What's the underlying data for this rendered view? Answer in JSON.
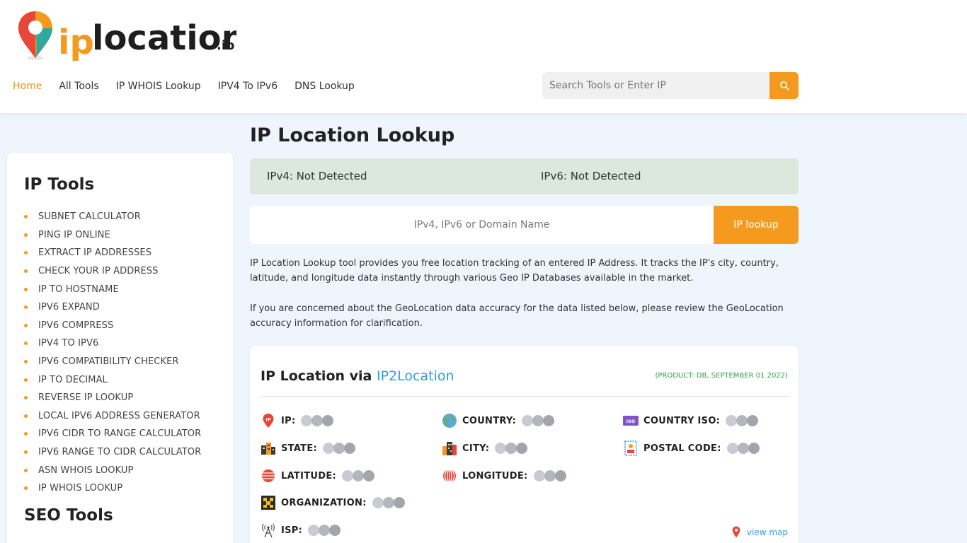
{
  "header": {
    "logo": {
      "brand_prefix": "ip",
      "brand_main": "location",
      "brand_suffix": ".io"
    },
    "nav": [
      "Home",
      "All Tools",
      "IP WHOIS Lookup",
      "IPV4 To IPv6",
      "DNS Lookup"
    ],
    "search_placeholder": "Search Tools or Enter IP"
  },
  "sidebar": {
    "ip_tools_title": "IP Tools",
    "ip_tools": [
      "SUBNET CALCULATOR",
      "PING IP ONLINE",
      "EXTRACT IP ADDRESSES",
      "CHECK YOUR IP ADDRESS",
      "IP TO HOSTNAME",
      "IPV6 EXPAND",
      "IPV6 COMPRESS",
      "IPV4 TO IPV6",
      "IPV6 COMPATIBILITY CHECKER",
      "IP TO DECIMAL",
      "REVERSE IP LOOKUP",
      "LOCAL IPV6 ADDRESS GENERATOR",
      "IPV6 CIDR TO RANGE CALCULATOR",
      "IPV6 RANGE TO CIDR CALCULATOR",
      "ASN WHOIS LOOKUP",
      "IP WHOIS LOOKUP"
    ],
    "seo_tools_title": "SEO Tools"
  },
  "main": {
    "title": "IP Location Lookup",
    "ipv4_status": "IPv4: Not Detected",
    "ipv6_status": "IPv6: Not Detected",
    "lookup_placeholder": "IPv4, IPv6 or Domain Name",
    "lookup_button": "IP lookup",
    "paragraph1": "IP Location Lookup tool provides you free location tracking of an entered IP Address. It tracks the IP's city, country, latitude, and longitude data instantly through various Geo IP Databases available in the market.",
    "paragraph2": "If you are concerned about the GeoLocation data accuracy for the data listed below, please review the GeoLocation accuracy information for clarification."
  },
  "card": {
    "title_prefix": "IP Location via ",
    "title_link": "IP2Location",
    "product": "(PRODUCT: DB, SEPTEMBER 01 2022)",
    "fields": {
      "ip": "IP:",
      "country": "COUNTRY:",
      "country_iso": "COUNTRY ISO:",
      "state": "STATE:",
      "city": "CITY:",
      "postal_code": "POSTAL CODE:",
      "latitude": "LATITUDE:",
      "longitude": "LONGITUDE:",
      "organization": "ORGANIZATION:",
      "isp": "ISP:"
    },
    "iso_badge": "ISO",
    "view_map": "view map"
  },
  "colors": {
    "accent": "#f39a1f",
    "link": "#2f9fe0",
    "product_green": "#2e9c47",
    "status_bg": "#dde8dc",
    "page_bg": "#eef5fc"
  }
}
